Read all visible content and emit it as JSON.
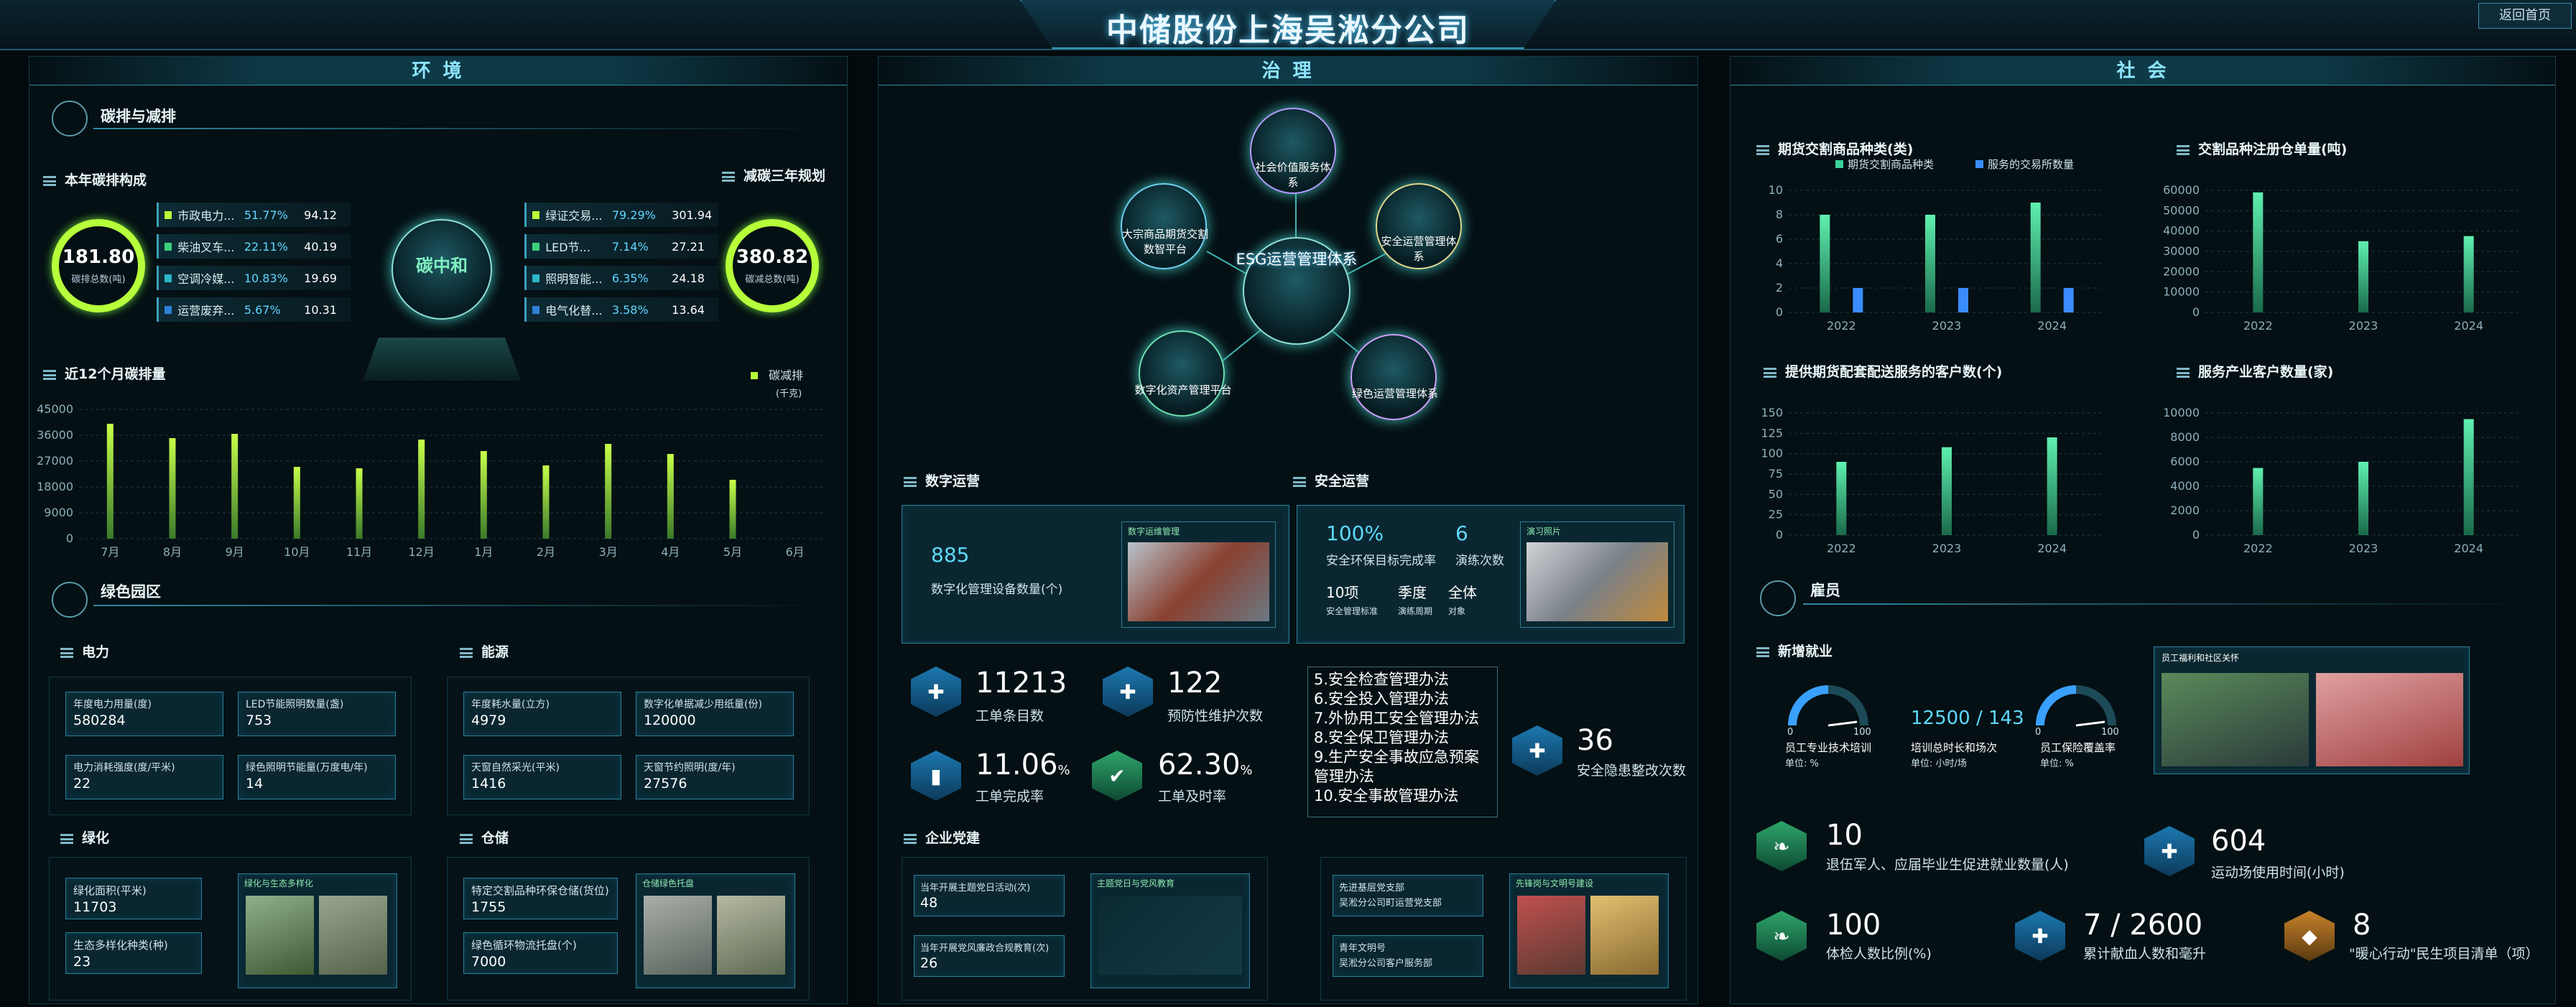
{
  "header": {
    "title": "中储股份上海吴淞分公司",
    "back": "返回首页"
  },
  "env": {
    "title": "环 境",
    "carbon_section": "碳排与减排",
    "composition_title": "本年碳排构成",
    "plan_title": "减碳三年规划",
    "ring_left": {
      "value": "181.80",
      "label": "碳排总数(吨)"
    },
    "ring_right": {
      "value": "380.82",
      "label": "碳减总数(吨)"
    },
    "center_label": "碳中和",
    "left_legend": [
      {
        "name": "市政电力...",
        "pct": "51.77%",
        "val": "94.12",
        "color": "#b6ff3a"
      },
      {
        "name": "柴油叉车...",
        "pct": "22.11%",
        "val": "40.19",
        "color": "#3ad17a"
      },
      {
        "name": "空调冷媒...",
        "pct": "10.83%",
        "val": "19.69",
        "color": "#2fb5c8"
      },
      {
        "name": "运营废弃...",
        "pct": "5.67%",
        "val": "10.31",
        "color": "#2f7fd8"
      }
    ],
    "right_legend": [
      {
        "name": "绿证交易...",
        "pct": "79.29%",
        "val": "301.94",
        "color": "#b6ff3a"
      },
      {
        "name": "LED节...",
        "pct": "7.14%",
        "val": "27.21",
        "color": "#3ad17a"
      },
      {
        "name": "照明智能...",
        "pct": "6.35%",
        "val": "24.18",
        "color": "#2fb5c8"
      },
      {
        "name": "电气化替...",
        "pct": "3.58%",
        "val": "13.64",
        "color": "#2f7fd8"
      }
    ],
    "monthly_title": "近12个月碳排量",
    "green_section": "绿色园区",
    "power": {
      "title": "电力",
      "items": [
        {
          "label": "年度电力用量(度)",
          "value": "580284"
        },
        {
          "label": "LED节能照明数量(盏)",
          "value": "753"
        },
        {
          "label": "电力消耗强度(度/平米)",
          "value": "22"
        },
        {
          "label": "绿色照明节能量(万度电/年)",
          "value": "14"
        }
      ]
    },
    "energy": {
      "title": "能源",
      "items": [
        {
          "label": "年度耗水量(立方)",
          "value": "4979"
        },
        {
          "label": "数字化单据减少用纸量(份)",
          "value": "120000"
        },
        {
          "label": "天窗自然采光(平米)",
          "value": "1416"
        },
        {
          "label": "天窗节约照明(度/年)",
          "value": "27576"
        }
      ]
    },
    "greening": {
      "title": "绿化",
      "items": [
        {
          "label": "绿化面积(平米)",
          "value": "11703"
        },
        {
          "label": "生态多样化种类(种)",
          "value": "23"
        }
      ],
      "photo_label": "绿化与生态多样化"
    },
    "storage": {
      "title": "仓储",
      "items": [
        {
          "label": "特定交割品种环保仓储(货位)",
          "value": "1755"
        },
        {
          "label": "绿色循环物流托盘(个)",
          "value": "7000"
        }
      ],
      "photo_label": "仓储绿色托盘"
    }
  },
  "gov": {
    "title": "治 理",
    "center": "ESG运营管理体系",
    "nodes": [
      "社会价值服务体系",
      "大宗商品期货交割数智平台",
      "安全运营管理体系",
      "数字化资产管理平台",
      "绿色运营管理体系"
    ],
    "digital": {
      "title": "数字运营",
      "value": "885",
      "label": "数字化管理设备数量(个)",
      "photo_label": "数字运维管理"
    },
    "safety": {
      "title": "安全运营",
      "pct": "100%",
      "pct_label": "安全环保目标完成率",
      "drills": "6",
      "drills_label": "演练次数",
      "s1": "10项",
      "s1l": "安全管理标准",
      "s2": "季度",
      "s2l": "演练周期",
      "s3": "全体",
      "s3l": "对象",
      "photo_label": "演习照片"
    },
    "stats": [
      {
        "value": "11213",
        "label": "工单条目数"
      },
      {
        "value": "122",
        "label": "预防性维护次数"
      },
      {
        "value": "11.06",
        "unit": "%",
        "label": "工单完成率"
      },
      {
        "value": "62.30",
        "unit": "%",
        "label": "工单及时率"
      }
    ],
    "rules": [
      "5.安全检查管理办法",
      "6.安全投入管理办法",
      "7.外协用工安全管理办法",
      "8.安全保卫管理办法",
      "9.生产安全事故应急预案管理办法",
      "10.安全事故管理办法"
    ],
    "hazard": {
      "value": "36",
      "label": "安全隐患整改次数"
    },
    "party": {
      "title": "企业党建",
      "items": [
        {
          "label": "当年开展主题党日活动(次)",
          "value": "48"
        },
        {
          "label": "当年开展党风廉政合规教育(次)",
          "value": "26"
        }
      ],
      "photo_label": "主题党日与党风教育",
      "items2": [
        {
          "label": "先进基层党支部",
          "value": "吴淞分公司町运营党支部"
        },
        {
          "label": "青年文明号",
          "value": "吴淞分公司客户服务部"
        }
      ],
      "photo2_label": "先锋岗与文明号建设"
    }
  },
  "soc": {
    "title": "社 会",
    "c1_title": "期货交割商品种类(类)",
    "c2_title": "交割品种注册仓单量(吨)",
    "c3_title": "提供期货配套配送服务的客户数(个)",
    "c4_title": "服务产业客户数量(家)",
    "emp_section": "雇员",
    "newjob": "新增就业",
    "gauge1": {
      "label": "员工专业技术培训",
      "unit": "单位: %",
      "min": "0",
      "max": "100"
    },
    "gauge2": {
      "label": "员工保险覆盖率",
      "unit": "单位: %",
      "min": "0",
      "max": "100"
    },
    "training": {
      "value": "12500 / 143",
      "label": "培训总时长和场次",
      "unit": "单位: 小时/场"
    },
    "photo_label": "员工福利和社区关怀",
    "stats": [
      {
        "value": "10",
        "label": "退伍军人、应届毕业生促进就业数量(人)"
      },
      {
        "value": "604",
        "label": "运动场使用时间(小时)"
      },
      {
        "value": "100",
        "label": "体检人数比例(%)"
      },
      {
        "value": "7 / 2600",
        "label": "累计献血人数和毫升"
      },
      {
        "value": "8",
        "label": "\"暖心行动\"民生项目清单（项）"
      }
    ]
  },
  "chart_data": [
    {
      "type": "bar",
      "title": "近12个月碳排量",
      "categories": [
        "7月",
        "8月",
        "9月",
        "10月",
        "11月",
        "12月",
        "1月",
        "2月",
        "3月",
        "4月",
        "5月",
        "6月"
      ],
      "series": [
        {
          "name": "碳减排",
          "values": [
            40000,
            35000,
            36500,
            25000,
            24500,
            34500,
            30500,
            25500,
            33000,
            29500,
            20500,
            0
          ]
        }
      ],
      "ylim": [
        0,
        45000
      ],
      "yticks": [
        0,
        9000,
        18000,
        27000,
        36000,
        45000
      ],
      "unit": "(千克)",
      "legend": "top-right"
    },
    {
      "type": "bar",
      "title": "期货交割商品种类(类)",
      "categories": [
        "2022",
        "2023",
        "2024"
      ],
      "series": [
        {
          "name": "期货交割商品种类",
          "values": [
            8,
            8,
            9
          ],
          "color": "#3ad19a"
        },
        {
          "name": "服务的交易所数量",
          "values": [
            2,
            2,
            2
          ],
          "color": "#3a8cff"
        }
      ],
      "ylim": [
        0,
        10
      ],
      "yticks": [
        0,
        2,
        4,
        6,
        8,
        10
      ]
    },
    {
      "type": "bar",
      "title": "交割品种注册仓单量(吨)",
      "categories": [
        "2022",
        "2023",
        "2024"
      ],
      "series": [
        {
          "name": "",
          "values": [
            59000,
            35000,
            37500
          ]
        }
      ],
      "ylim": [
        0,
        60000
      ],
      "yticks": [
        0,
        10000,
        20000,
        30000,
        40000,
        50000,
        60000
      ]
    },
    {
      "type": "bar",
      "title": "提供期货配套配送服务的客户数(个)",
      "categories": [
        "2022",
        "2023",
        "2024"
      ],
      "series": [
        {
          "name": "",
          "values": [
            90,
            108,
            120
          ]
        }
      ],
      "ylim": [
        0,
        150
      ],
      "yticks": [
        0,
        25,
        50,
        75,
        100,
        125,
        150
      ]
    },
    {
      "type": "bar",
      "title": "服务产业客户数量(家)",
      "categories": [
        "2022",
        "2023",
        "2024"
      ],
      "series": [
        {
          "name": "",
          "values": [
            5500,
            6000,
            9500
          ]
        }
      ],
      "ylim": [
        0,
        10000
      ],
      "yticks": [
        0,
        2000,
        4000,
        6000,
        8000,
        10000
      ]
    }
  ]
}
